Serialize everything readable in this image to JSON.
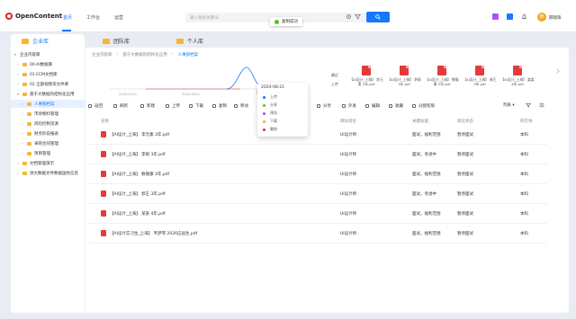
{
  "app": {
    "name": "OpenContent"
  },
  "nav": {
    "items": [
      "首页",
      "工作台",
      "运营"
    ]
  },
  "search": {
    "placeholder": "输入搜索关键词"
  },
  "toast": {
    "text": "复制成功"
  },
  "user": {
    "avatar_initial": "邢",
    "name": "邢晓珠"
  },
  "spaces": {
    "tabs": [
      "企业库",
      "团队库",
      "个人库"
    ]
  },
  "tree": {
    "items": [
      "企业内容库",
      "00-AI数据库",
      "01 ECM文档库",
      "02 全部视频资文件库",
      "基于大数据的结构化应用",
      "人事部档案",
      "市场物料管理",
      "风险控制资源",
      "财务阶段报表",
      "采购合同管理",
      "项目管理",
      "文档管理演示",
      "领大数据文件数据国色信息"
    ]
  },
  "breadcrumb": {
    "items": [
      "企业内容库",
      "基于大数据的结构化应用",
      "人事部档案"
    ]
  },
  "timeline": {
    "dates": [
      "2024-05-0",
      "2024-06-0",
      "2024-08-21"
    ]
  },
  "popup": {
    "title": "2024-08-21",
    "rows": [
      {
        "label": "上传",
        "color": "#1677ff"
      },
      {
        "label": "分享",
        "color": "#52c41a"
      },
      {
        "label": "预览",
        "color": "#9254de"
      },
      {
        "label": "下载",
        "color": "#faad14"
      },
      {
        "label": "删除",
        "color": "#f5222d"
      }
    ]
  },
  "versions": {
    "side_labels": [
      "最近",
      "上传"
    ],
    "thumbs": [
      "【AI设计_上海】 李元素 3年.pdf",
      "【AI设计_上海】 李硕 3年.pdf",
      "【AI设计_上海】 数隆康 3年.pdf",
      "【AI设计_上海】 郭王 3年.pdf",
      "【AI设计_上海】 某某 4年.pdf"
    ]
  },
  "toolbar": {
    "tools": [
      "返回",
      "刷新",
      "新建",
      "上传",
      "下载",
      "复制",
      "移动",
      "分享",
      "外发",
      "编辑",
      "收藏",
      "分配权限"
    ],
    "view": "列表"
  },
  "table": {
    "headers": [
      "名称",
      "目标岗位",
      "关键技能",
      "岗位状态",
      "所在地"
    ],
    "rows": [
      {
        "name": "【AI设计_上海】 李元素 3年.pdf",
        "position": "UI设计师",
        "skill": "面试，福利范围",
        "status": "暂停面试",
        "city": "本科"
      },
      {
        "name": "【AI设计_上海】 李硕 3年.pdf",
        "position": "UI设计师",
        "skill": "面试，考虑中",
        "status": "暂停面试",
        "city": "本科"
      },
      {
        "name": "【AI设计_上海】 数隆康 3年.pdf",
        "position": "UI设计师",
        "skill": "面试，福利范围",
        "status": "暂停面试",
        "city": "本科"
      },
      {
        "name": "【AI设计_上海】 郭王 3年.pdf",
        "position": "UI设计师",
        "skill": "面试，考虑中",
        "status": "暂停面试",
        "city": "本科"
      },
      {
        "name": "【AI设计_上海】 某某 4年.pdf",
        "position": "UI设计师",
        "skill": "面试，福利范围",
        "status": "暂停面试",
        "city": "本科"
      },
      {
        "name": "【AI设计实习生_上海】 韦梦琴 2026应届生.pdf",
        "position": "UI设计师",
        "skill": "面试，福利范围",
        "status": "暂停面试",
        "city": "本科"
      }
    ]
  },
  "colors": {
    "accent": "#1677ff",
    "pdf": "#e23b3b",
    "folder": "#f7b733"
  }
}
